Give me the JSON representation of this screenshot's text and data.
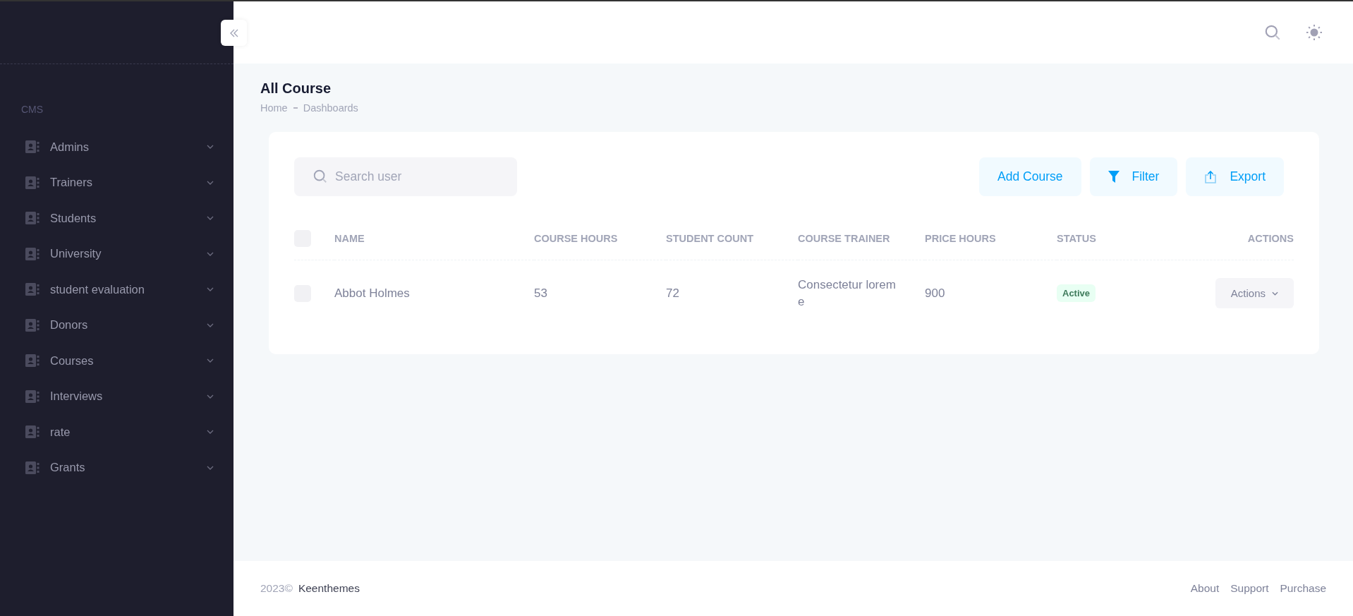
{
  "sidebar": {
    "section": "CMS",
    "items": [
      {
        "label": "Admins",
        "expanded": false
      },
      {
        "label": "Trainers",
        "expanded": false
      },
      {
        "label": "Students",
        "expanded": false
      },
      {
        "label": "University",
        "expanded": false
      },
      {
        "label": "student evaluation",
        "expanded": false
      },
      {
        "label": "Donors",
        "expanded": false
      },
      {
        "label": "Courses",
        "expanded": false
      },
      {
        "label": "Interviews",
        "expanded": false
      },
      {
        "label": "rate",
        "expanded": false
      },
      {
        "label": "Grants",
        "expanded": false
      }
    ]
  },
  "page": {
    "title": "All Course",
    "breadcrumb": [
      "Home",
      "Dashboards"
    ]
  },
  "toolbar": {
    "search": {
      "placeholder": "Search user"
    },
    "buttons": [
      {
        "label": "Add Course",
        "kind": "plain"
      },
      {
        "label": "Filter",
        "kind": "filter"
      },
      {
        "label": "Export",
        "kind": "export"
      }
    ]
  },
  "table": {
    "select_all_checked": false,
    "columns": [
      "NAME",
      "COURSE HOURS",
      "STUDENT COUNT",
      "COURSE TRAINER",
      "PRICE HOURS",
      "STATUS",
      "ACTIONS"
    ],
    "rows": [
      {
        "checked": false,
        "name": "Abbot Holmes",
        "course_hours": "53",
        "student_count": "72",
        "course_trainer": "Consectetur lorem e",
        "price_hours": "900",
        "status": {
          "label": "Active",
          "color": "#e8fff3"
        },
        "action": "Actions"
      }
    ]
  },
  "footer": {
    "year": "2023©",
    "brand": "Keenthemes",
    "links": [
      "About",
      "Support",
      "Purchase"
    ]
  }
}
